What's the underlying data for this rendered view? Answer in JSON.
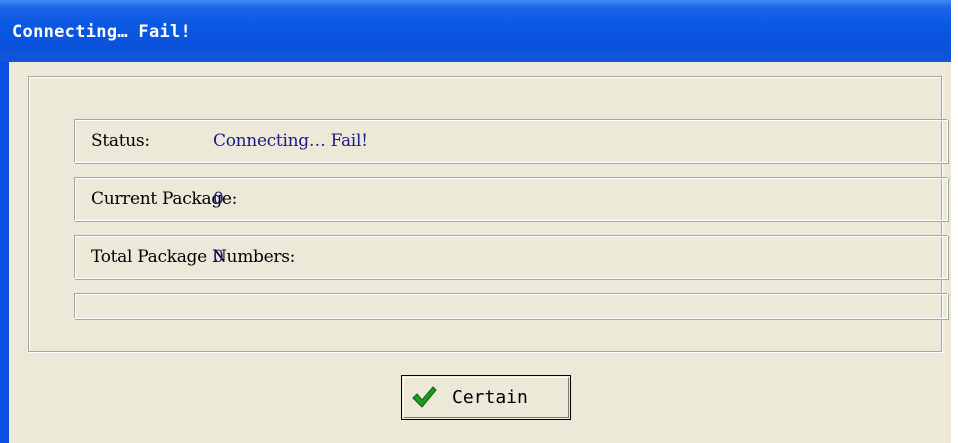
{
  "window": {
    "title": "Connecting… Fail!"
  },
  "status": {
    "label": "Status:",
    "value": "Connecting… Fail!"
  },
  "current_package": {
    "label": "Current Package:",
    "value": "0"
  },
  "total_package_numbers": {
    "label": "Total Package Numbers:",
    "value": "0"
  },
  "progress": {
    "fraction": 0
  },
  "buttons": {
    "certain_label": "Certain",
    "certain_icon": "checkmark-icon"
  },
  "colors": {
    "titlebar": "#0a52dc",
    "window_background": "#ece9d8",
    "value_text": "#1a1a8c",
    "checkmark": "#1f9b1f"
  }
}
